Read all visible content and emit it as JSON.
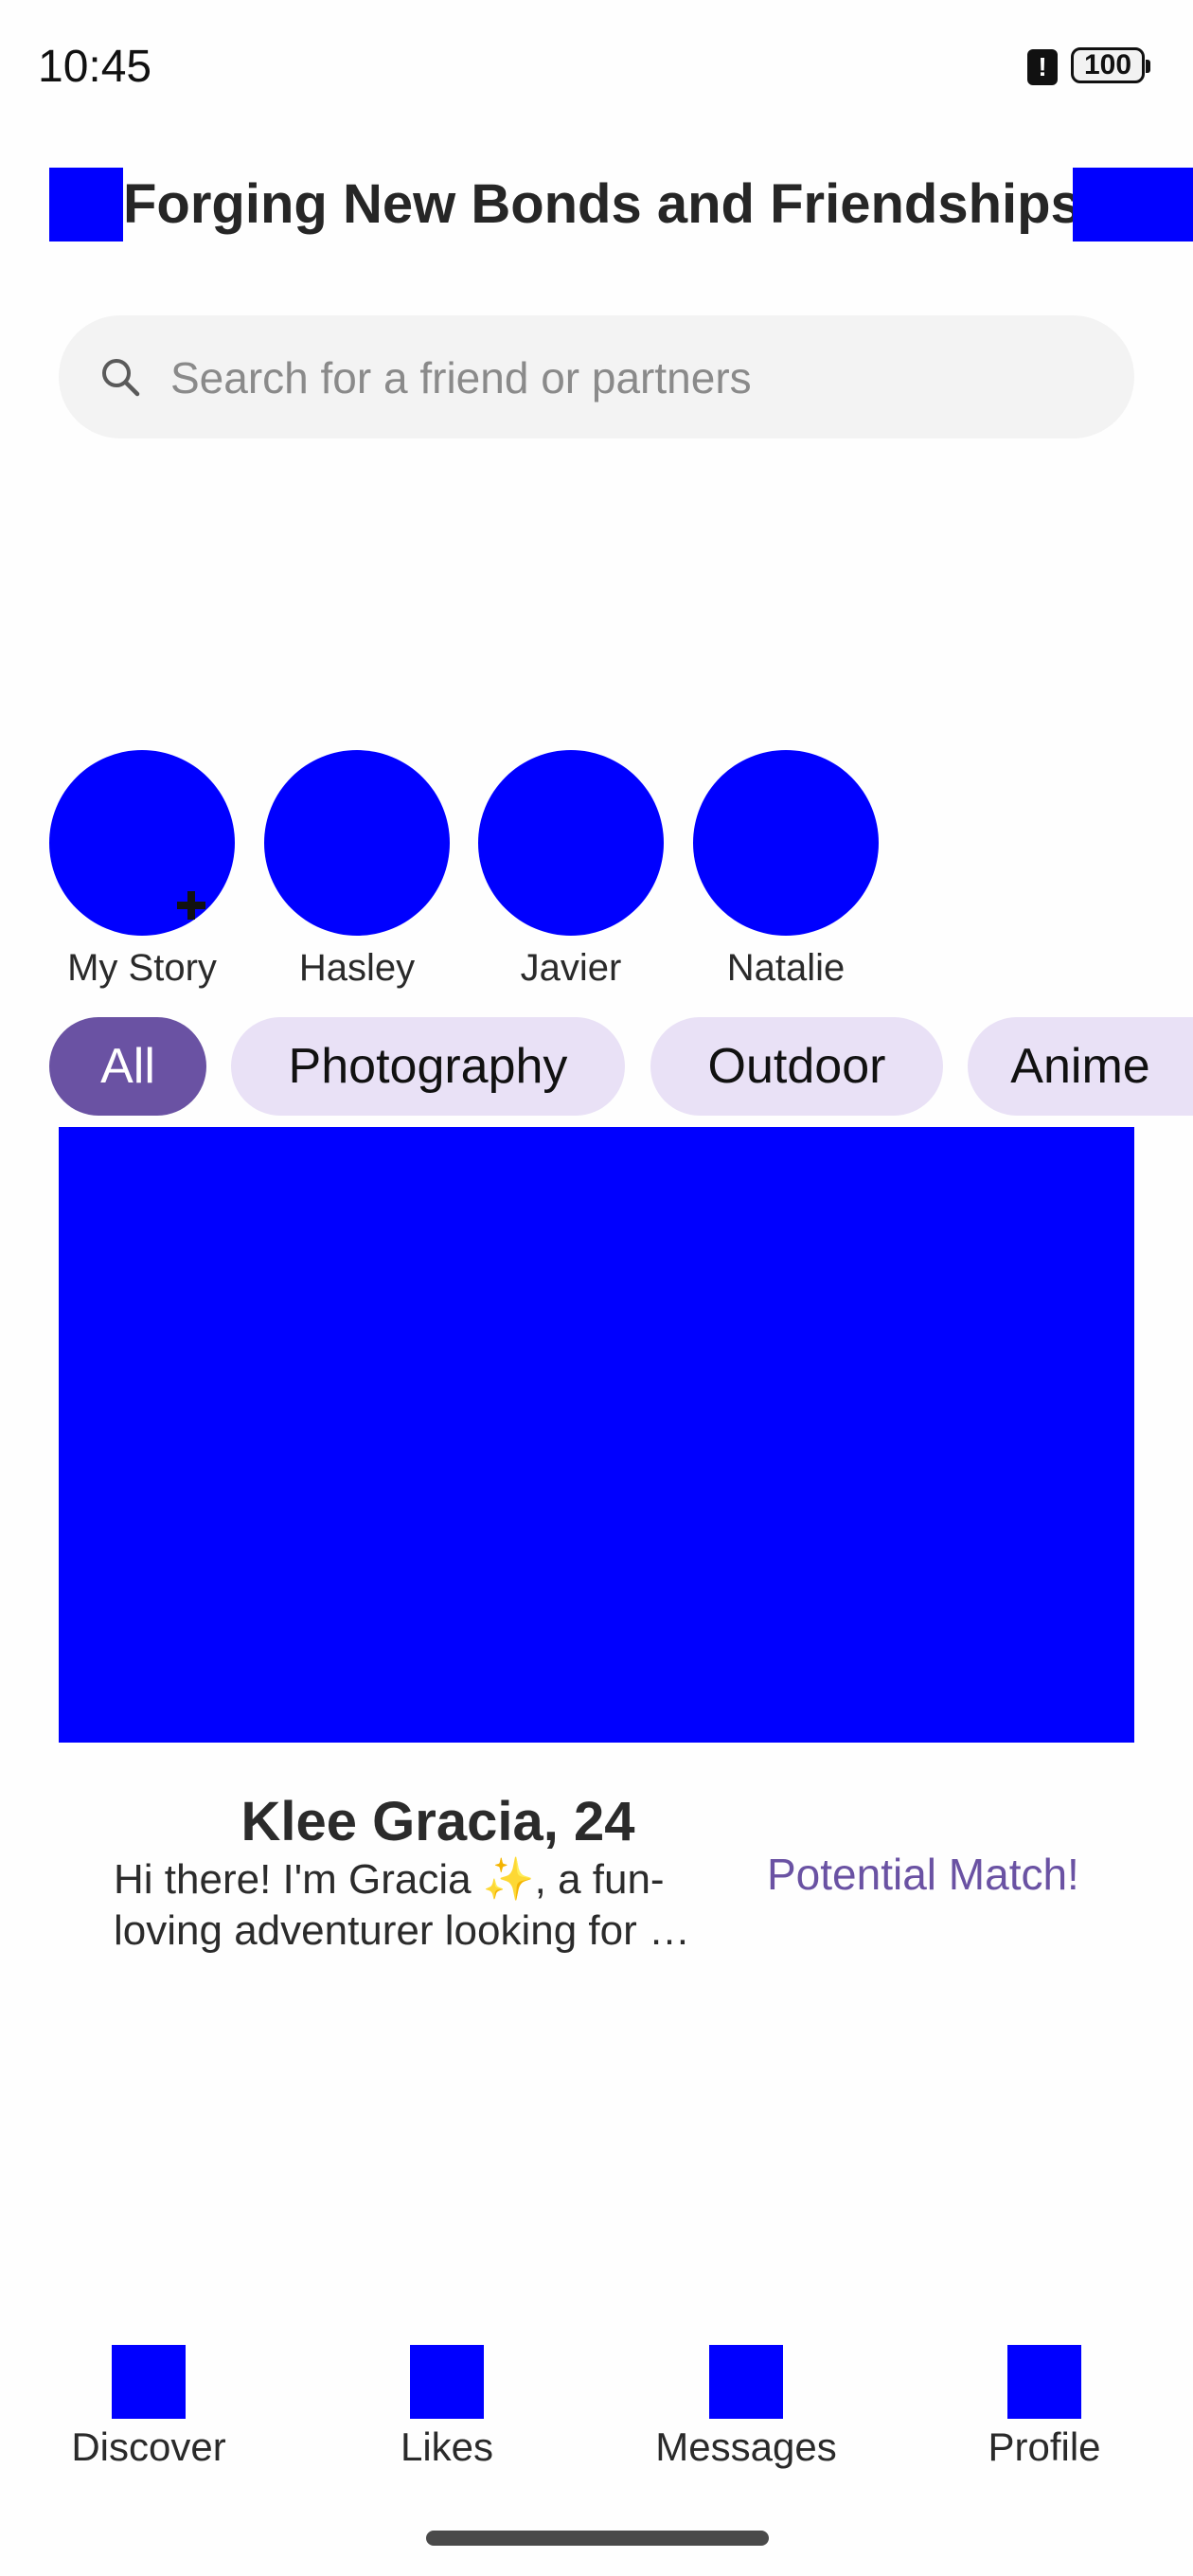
{
  "status_bar": {
    "time": "10:45",
    "alert_icon": "!",
    "battery_level": "100"
  },
  "header": {
    "title": "Forging New Bonds and Friendships"
  },
  "search": {
    "placeholder": "Search for a friend or partners",
    "value": ""
  },
  "stories": [
    {
      "name": "My Story"
    },
    {
      "name": "Hasley"
    },
    {
      "name": "Javier"
    },
    {
      "name": "Natalie"
    }
  ],
  "categories": [
    {
      "label": "All",
      "selected": true
    },
    {
      "label": "Photography",
      "selected": false
    },
    {
      "label": "Outdoor",
      "selected": false
    },
    {
      "label": "Anime",
      "selected": false
    }
  ],
  "profile_card": {
    "name_age": "Klee Gracia, 24",
    "bio": "Hi there! I'm Gracia ✨, a fun-loving adventurer looking for …",
    "match_status": "Potential Match!"
  },
  "bottom_nav": [
    {
      "label": "Discover"
    },
    {
      "label": "Likes"
    },
    {
      "label": "Messages"
    },
    {
      "label": "Profile"
    }
  ],
  "colors": {
    "accent": "#6a52a3",
    "chip_inactive": "#e9e1f6",
    "placeholder_block": "#0000ff",
    "search_bg": "#f3f3f3"
  }
}
